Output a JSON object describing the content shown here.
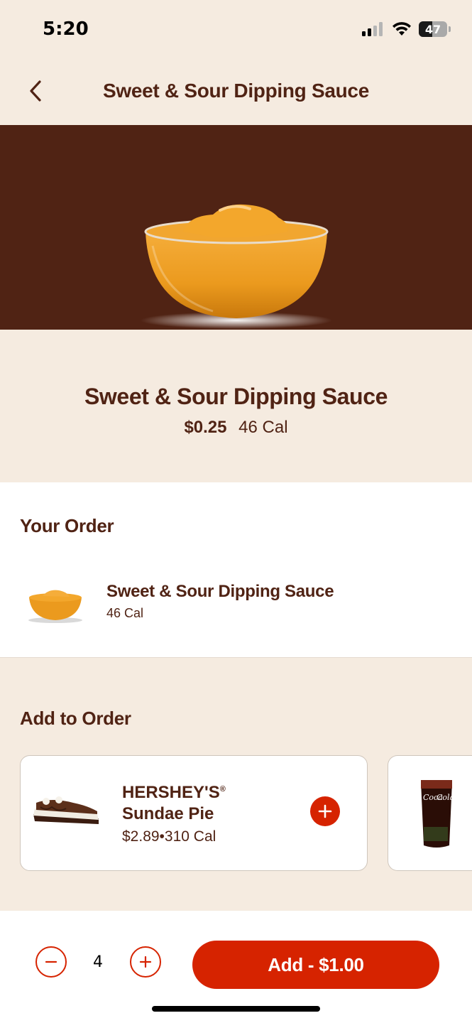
{
  "status_bar": {
    "time": "5:20",
    "battery": "47"
  },
  "header": {
    "title": "Sweet & Sour Dipping Sauce"
  },
  "item": {
    "name": "Sweet & Sour Dipping Sauce",
    "price": "$0.25",
    "calories": "46 Cal"
  },
  "your_order": {
    "title": "Your Order",
    "items": [
      {
        "name": "Sweet & Sour Dipping Sauce",
        "calories": "46 Cal"
      }
    ]
  },
  "add_to_order": {
    "title": "Add to Order",
    "cards": [
      {
        "name_line1": "HERSHEY'S",
        "trademark": "®",
        "name_line2": "Sundae Pie",
        "price_cal": "$2.89•310 Cal"
      }
    ]
  },
  "footer": {
    "quantity": "4",
    "add_label": "Add - $1.00"
  },
  "colors": {
    "brand_brown": "#502314",
    "brand_red": "#d62300",
    "cream": "#f5ebe0"
  }
}
